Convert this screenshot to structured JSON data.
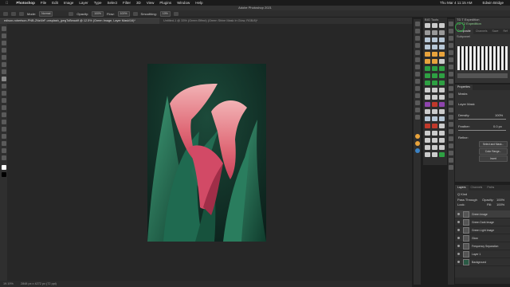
{
  "menubar": {
    "app": "Photoshop",
    "items": [
      "File",
      "Edit",
      "Image",
      "Layer",
      "Type",
      "Select",
      "Filter",
      "3D",
      "View",
      "Plugins",
      "Window",
      "Help"
    ],
    "clock": "Thu Mar 4 11:15 AM",
    "user": "Edwin Bridge"
  },
  "window": {
    "title": "Adobe Photoshop 2021"
  },
  "options": {
    "mode_label": "Mode:",
    "mode_value": "Normal",
    "opacity_label": "Opacity:",
    "opacity_value": "100%",
    "flow_label": "Flow:",
    "flow_value": "100%",
    "smoothing_label": "Smoothing:",
    "smoothing_value": "10%"
  },
  "tabs": [
    {
      "label": "edison-robertson-PNB-2Nz6IrF-unsplash_jpegToBeautif @ 12.5% (Green Image, Layer Mask/16)*",
      "active": true
    },
    {
      "label": "Untitled-1 @ 33% (Green Effect) (Green Shine Mask In Glow, RGB/8)*",
      "active": false
    }
  ],
  "status": {
    "zoom": "19.19%",
    "doc": "2848 px x 4272 px (72 ppi)"
  },
  "panels": {
    "bigtools_title": "BIG Tools",
    "tdtp_title": "TD T Expedition",
    "tdtp_sub": "TD T2 Expedition",
    "tdtp_tabs": [
      "Composite",
      "Channels",
      "Save",
      "Ref"
    ],
    "tdtp_section": "Subpanel",
    "props_title": "Properties",
    "props_sub": "Masks",
    "props_mask": "Layer Mask",
    "props_density_label": "Density:",
    "props_density_value": "100%",
    "props_feather_label": "Feather:",
    "props_feather_value": "0.0 px",
    "props_refine": "Refine:",
    "props_btn1": "Select and Mask...",
    "props_btn2": "Color Range...",
    "props_btn3": "Invert"
  },
  "layers_panel": {
    "tabs": [
      "Layers",
      "Channels",
      "Paths"
    ],
    "kind_label": "Q Kind",
    "blend": "Pass Through",
    "opacity_label": "Opacity:",
    "opacity_value": "100%",
    "lock_label": "Lock:",
    "fill_label": "Fill:",
    "fill_value": "100%",
    "layers": [
      {
        "name": "Green Image",
        "selected": true
      },
      {
        "name": "Green Dark Image",
        "selected": false
      },
      {
        "name": "Green Light Image",
        "selected": false
      },
      {
        "name": "Glow",
        "selected": false
      },
      {
        "name": "Frequency Separation",
        "selected": false
      },
      {
        "name": "Layer 1",
        "selected": false
      },
      {
        "name": "Background",
        "selected": false
      }
    ]
  },
  "colors": {
    "accent": "#2ea043",
    "tool_orange": "#e8a33c",
    "tool_red": "#c0392b",
    "tool_purple": "#8e44ad"
  }
}
